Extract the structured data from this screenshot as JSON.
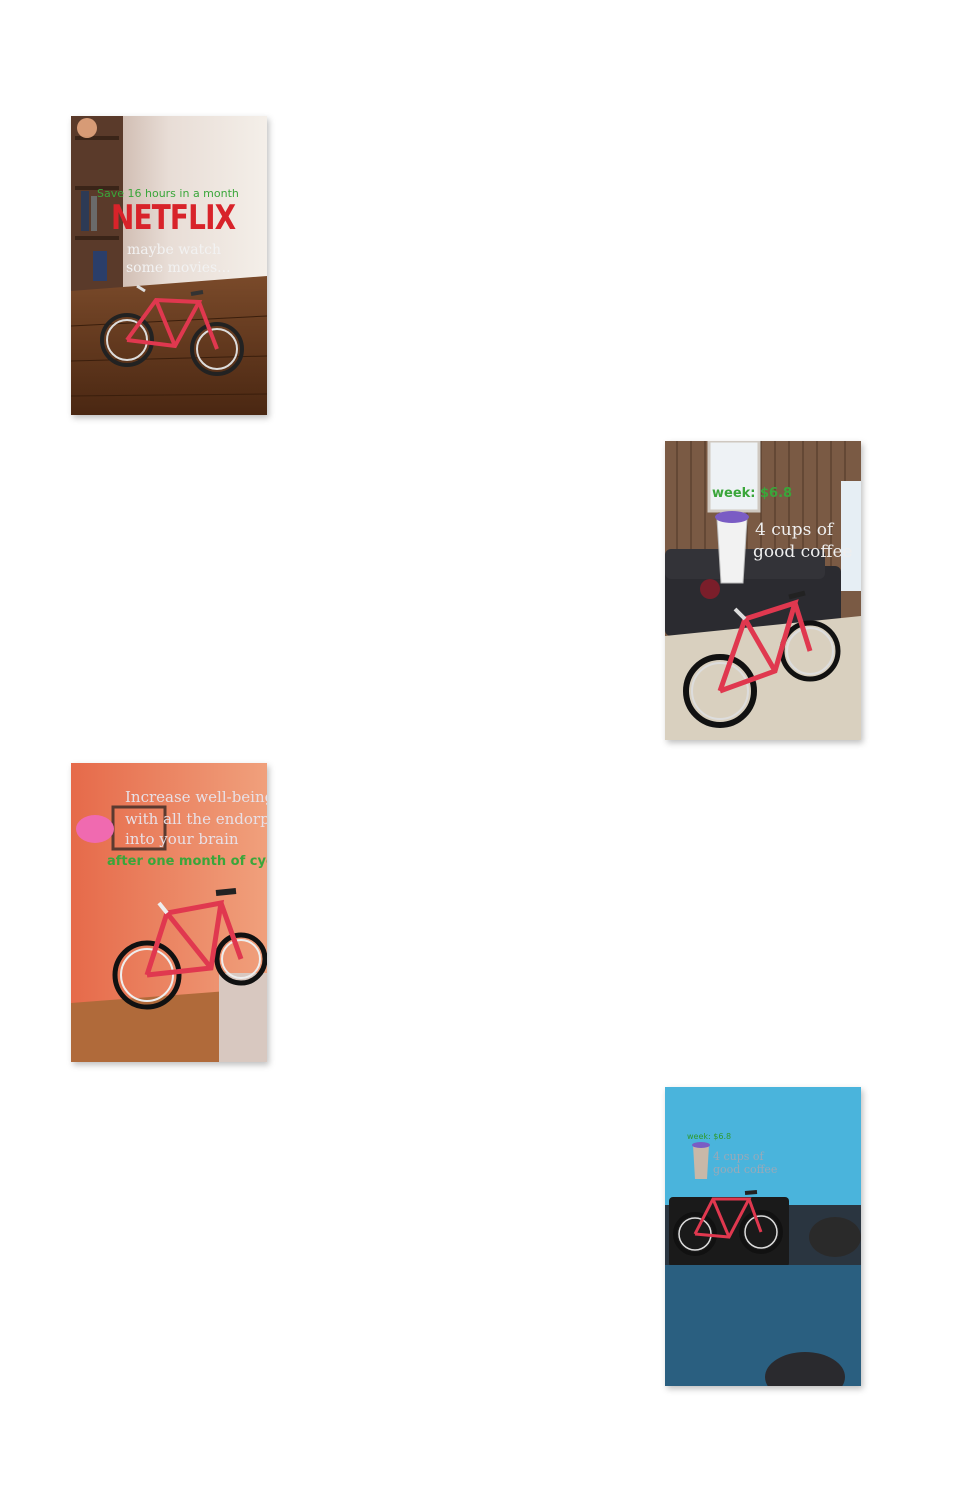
{
  "frames": [
    {
      "id": "netflix",
      "top_text": "Save 16 hours in a month",
      "logo_text": "NETFLIX",
      "caption_line1": "maybe watch",
      "caption_line2": "some movies..."
    },
    {
      "id": "coffee-couch",
      "price_text": "week: $6.8",
      "caption_line1": "4 cups of",
      "caption_line2": "good coffee"
    },
    {
      "id": "brain",
      "caption_line1": "Increase well-being",
      "caption_line2": "with all the endorphins",
      "caption_line3": "into your brain",
      "bottom_text": "after one month of cycling"
    },
    {
      "id": "coffee-desk",
      "price_text": "week: $6.8",
      "caption_line1": "4 cups of",
      "caption_line2": "good coffee"
    }
  ],
  "colors": {
    "bike_red": "#e0384f",
    "green_text": "#3aa63a",
    "netflix_red": "#d8232a"
  }
}
